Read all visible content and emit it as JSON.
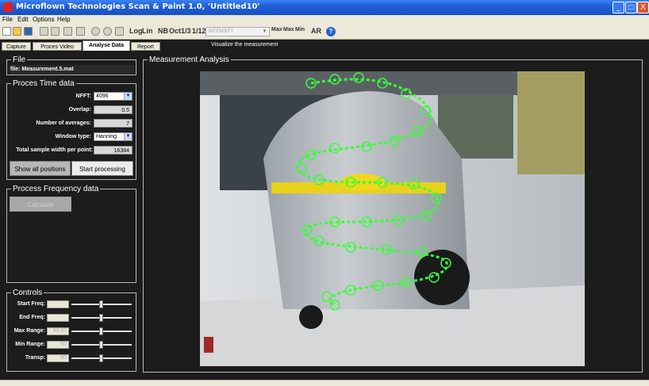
{
  "window": {
    "title": "Microflown Technologies Scan & Paint 1.0, 'Untitled10'",
    "minimize_label": "_",
    "maximize_label": "□",
    "close_label": "X"
  },
  "menu": {
    "items": [
      "File",
      "Edit",
      "Options",
      "Help"
    ]
  },
  "toolbar": {
    "log_label": "Log",
    "lin_label": "Lin",
    "nb_label": "NB",
    "oct_label": "Oct",
    "third_label": "1/3",
    "twelfth_label": "1/12",
    "intensity_placeholder": "INTENSITY",
    "max_label": "Max",
    "max2_label": "Max",
    "min_label": "Min",
    "ar_label": "AR",
    "help_label": "?"
  },
  "tabs": [
    {
      "label": "Capture",
      "active": false
    },
    {
      "label": "Proces Video",
      "active": false
    },
    {
      "label": "Analyse Data",
      "active": true
    },
    {
      "label": "Report",
      "active": false
    }
  ],
  "tab_hint": "Visualize the measurement",
  "file_panel": {
    "legend": "File",
    "file": "file: Measurement.5.mat"
  },
  "time_panel": {
    "legend": "Proces Time data",
    "nfft_label": "NFFT:",
    "nfft_value": "4096",
    "overlap_label": "Overlap:",
    "overlap_value": "0.5",
    "averages_label": "Number of averages:",
    "averages_value": "7",
    "window_label": "Window type:",
    "window_value": "Hanning",
    "width_label": "Total sample width per point:",
    "width_value": "16384",
    "show_all_label": "Show all positions",
    "start_processing_label": "Start processing"
  },
  "freq_panel": {
    "legend": "Process Frequency data",
    "calculate_label": "Calculate"
  },
  "controls": {
    "legend": "Controls",
    "start_freq_label": "Start Freq:",
    "end_freq_label": "End Freq:",
    "max_range_label": "Max Range:",
    "max_range_value": "50.07",
    "min_range_label": "Min Range:",
    "min_range_value": "50",
    "transp_label": "Transp:",
    "transp_value": "60"
  },
  "analysis": {
    "legend": "Measurement Analysis"
  },
  "colors": {
    "titlebar": "#1f5fd6",
    "marker": "#39ff39",
    "panel_bg": "#1c1c1c",
    "border": "#b8b8b8"
  }
}
